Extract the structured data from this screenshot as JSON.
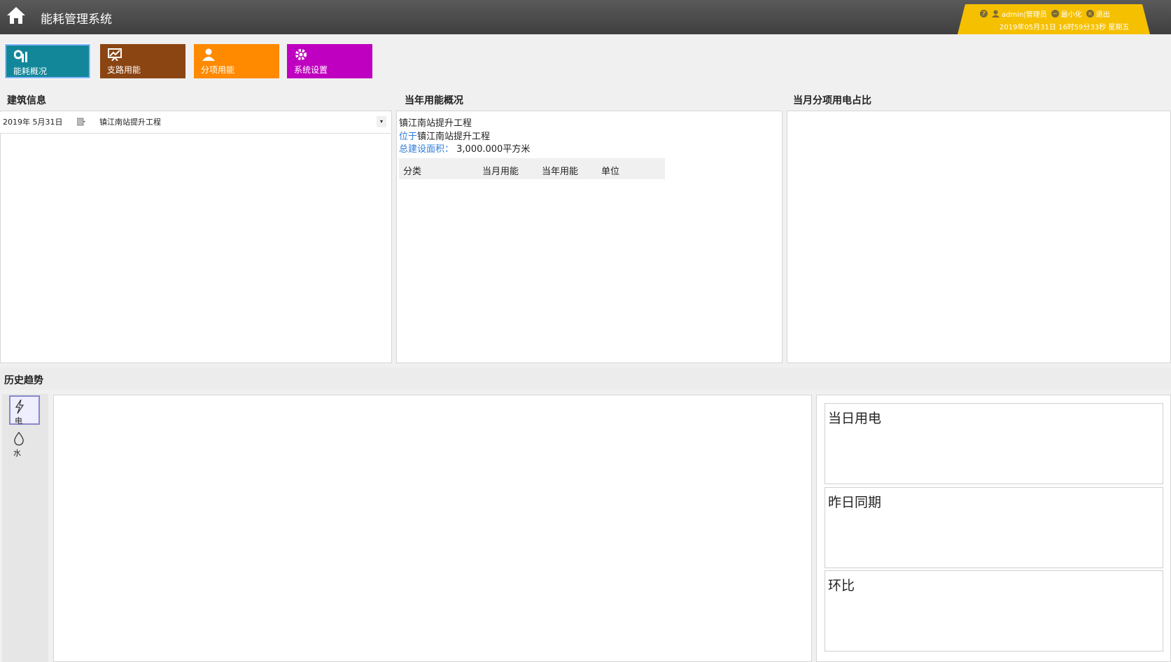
{
  "header": {
    "title": "能耗管理系统",
    "user_name": "admin|管理员",
    "minimize_label": "最小化",
    "logout_label": "退出",
    "datetime": "2019年05月31日 16时59分33秒 星期五"
  },
  "tiles": [
    {
      "label": "能耗概况",
      "icon": "energy-chart-icon",
      "color": "#13879a"
    },
    {
      "label": "支路用能",
      "icon": "branch-chart-icon",
      "color": "#8b4513"
    },
    {
      "label": "分项用能",
      "icon": "user-icon",
      "color": "#ff8a00"
    },
    {
      "label": "系统设置",
      "icon": "gear-icon",
      "color": "#c000c0"
    }
  ],
  "building": {
    "title": "建筑信息",
    "date_value": "2019年  5月31日",
    "project_value": "镇江南站提升工程"
  },
  "yearly": {
    "title": "当年用能概况",
    "project_name": "镇江南站提升工程",
    "location_label": "位于",
    "location_value": "镇江南站提升工程",
    "area_label": "总建设面积：",
    "area_value": "3,000.000平方米",
    "columns": [
      "分类",
      "当月用能",
      "当年用能",
      "单位"
    ]
  },
  "monthly": {
    "title": "当月分项用电占比"
  },
  "history": {
    "title": "历史趋势",
    "types": [
      {
        "label": "电",
        "icon": "lightning-icon",
        "active": true
      },
      {
        "label": "水",
        "icon": "water-drop-icon",
        "active": false
      }
    ],
    "stats": [
      "当日用电",
      "昨日同期",
      "环比"
    ]
  }
}
